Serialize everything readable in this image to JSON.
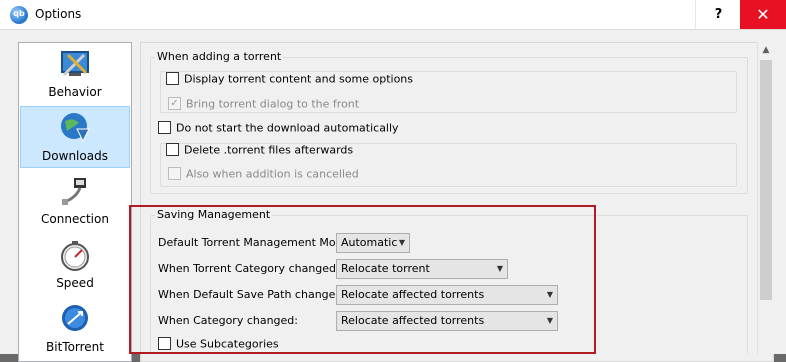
{
  "window": {
    "title": "Options",
    "app_icon_text": "qb",
    "help_label": "?",
    "close_label": "✕"
  },
  "nav": {
    "items": [
      {
        "label": "Behavior",
        "icon": "behavior-icon"
      },
      {
        "label": "Downloads",
        "icon": "downloads-icon",
        "selected": true
      },
      {
        "label": "Connection",
        "icon": "connection-icon"
      },
      {
        "label": "Speed",
        "icon": "speed-icon"
      },
      {
        "label": "BitTorrent",
        "icon": "bittorrent-icon"
      }
    ]
  },
  "adding": {
    "title": "When adding a torrent",
    "display_content": {
      "label": "Display torrent content and some options",
      "checked": false
    },
    "bring_front": {
      "label": "Bring torrent dialog to the front",
      "checked": true,
      "disabled": true
    },
    "do_not_start": {
      "label": "Do not start the download automatically",
      "checked": false
    },
    "delete_torrent": {
      "label": "Delete .torrent files afterwards",
      "checked": false
    },
    "also_cancelled": {
      "label": "Also when addition is cancelled",
      "checked": false,
      "disabled": true
    }
  },
  "saving": {
    "title": "Saving Management",
    "mode": {
      "label": "Default Torrent Management Mode:",
      "value": "Automatic"
    },
    "category_changed": {
      "label": "When Torrent Category changed:",
      "value": "Relocate torrent"
    },
    "save_path_changed": {
      "label": "When Default Save Path changed:",
      "value": "Relocate affected torrents"
    },
    "cat_changed": {
      "label": "When Category changed:",
      "value": "Relocate affected torrents"
    },
    "subcategories": {
      "label": "Use Subcategories",
      "checked": false
    }
  },
  "scroll": {
    "up_arrow": "▲"
  },
  "combo_arrow": "▼",
  "check_mark": "✓"
}
